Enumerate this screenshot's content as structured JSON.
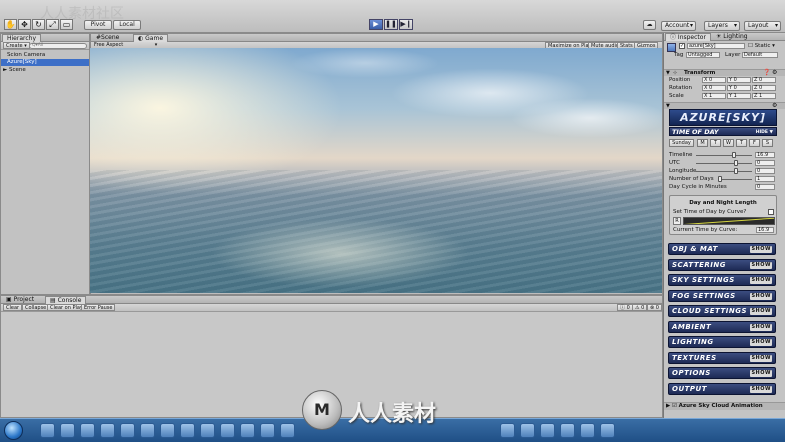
{
  "toolbar": {
    "pivot_label": "Pivot",
    "local_label": "Local",
    "account_label": "Account",
    "layers_label": "Layers",
    "layout_label": "Layout",
    "watermark_text": "人人素材社区"
  },
  "hierarchy": {
    "tab_label": "Hierarchy",
    "create_label": "Create",
    "search_placeholder": "Q▾All",
    "items": [
      "Scion Camera",
      "Azure[Sky]",
      "► Scene"
    ]
  },
  "scene_tabs": {
    "scene_label": "Scene",
    "game_label": "Game",
    "aspect_label": "Free Aspect",
    "buttons": [
      "Maximize on Play",
      "Mute audio",
      "Stats",
      "Gizmos"
    ]
  },
  "console": {
    "project_tab": "Project",
    "console_tab": "Console",
    "buttons": [
      "Clear",
      "Collapse",
      "Clear on Play",
      "Error Pause"
    ],
    "counts": [
      "0",
      "0",
      "0"
    ]
  },
  "inspector": {
    "tab_label": "Inspector",
    "lighting_tab": "Lighting",
    "object_name": "azure[Sky]",
    "static_label": "Static",
    "tag_label": "Tag",
    "tag_value": "Untagged",
    "layer_label": "Layer",
    "layer_value": "Default",
    "transform_label": "Transform",
    "position_label": "Position",
    "rotation_label": "Rotation",
    "scale_label": "Scale",
    "position": {
      "x": "X 0",
      "y": "Y 0",
      "z": "Z 0"
    },
    "rotation": {
      "x": "X 0",
      "y": "Y 0",
      "z": "Z 0"
    },
    "scale": {
      "x": "X 1",
      "y": "Y 1",
      "z": "Z 1"
    },
    "logo_text": "AZURE[SKY]",
    "time_of_day_label": "TIME OF DAY",
    "hide_label": "HIDE",
    "days": [
      "Sunday",
      "M",
      "T",
      "W",
      "T",
      "F",
      "S"
    ],
    "timeline_label": "Timeline",
    "timeline_value": "16.9",
    "timeline_fraction": 0.7,
    "utc_label": "UTC",
    "utc_value": "0",
    "longitude_label": "Longitude",
    "longitude_value": "0",
    "days_label": "Number of Days",
    "days_value": "1",
    "cycle_label": "Day Cycle in Minutes",
    "cycle_value": "0",
    "dn_title": "Day and Night Length",
    "curve_label": "Set Time of Day by Curve?",
    "curve_time_label": "Current Time by Curve:",
    "curve_time_value": "16.9",
    "sections": [
      "OBJ & MAT",
      "SCATTERING",
      "SKY SETTINGS",
      "FOG SETTINGS",
      "CLOUD SETTINGS",
      "AMBIENT",
      "LIGHTING",
      "TEXTURES",
      "OPTIONS",
      "OUTPUT"
    ],
    "show_label": "SHOW",
    "footer_component": "Azure Sky Cloud Animation"
  },
  "taskbar": {
    "watermark": "人人素材"
  }
}
